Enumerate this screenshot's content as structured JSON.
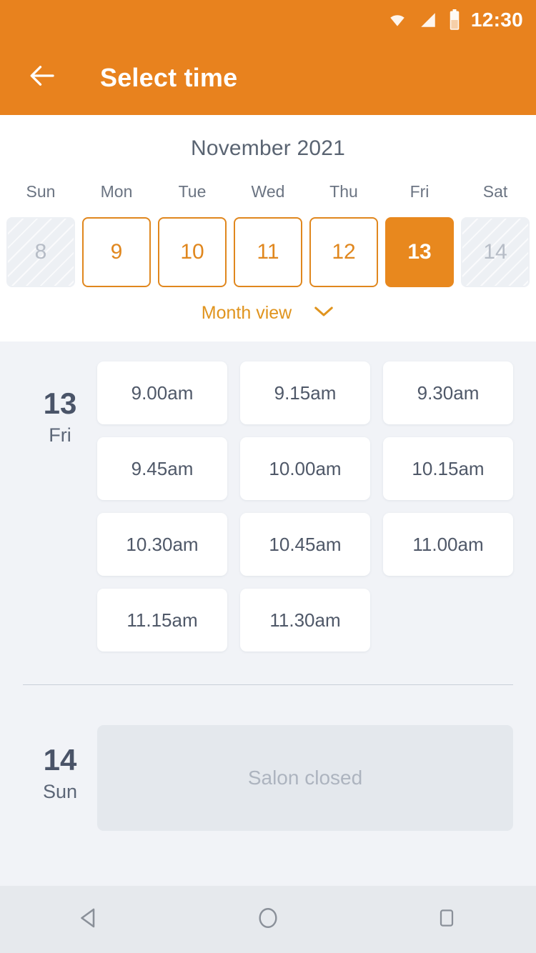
{
  "statusbar": {
    "time": "12:30",
    "icons": [
      "wifi-icon",
      "cell-signal-icon",
      "battery-icon"
    ]
  },
  "appbar": {
    "title": "Select time",
    "back_icon": "arrow-left-icon"
  },
  "calendar": {
    "month_label": "November 2021",
    "weekdays": [
      "Sun",
      "Mon",
      "Tue",
      "Wed",
      "Thu",
      "Fri",
      "Sat"
    ],
    "dates": [
      {
        "day": "8",
        "state": "disabled"
      },
      {
        "day": "9",
        "state": "available"
      },
      {
        "day": "10",
        "state": "available"
      },
      {
        "day": "11",
        "state": "available"
      },
      {
        "day": "12",
        "state": "available"
      },
      {
        "day": "13",
        "state": "selected"
      },
      {
        "day": "14",
        "state": "disabled"
      }
    ],
    "month_view_label": "Month view",
    "month_view_icon": "chevron-down-icon"
  },
  "days": [
    {
      "day_number": "13",
      "day_of_week": "Fri",
      "slots": [
        "9.00am",
        "9.15am",
        "9.30am",
        "9.45am",
        "10.00am",
        "10.15am",
        "10.30am",
        "10.45am",
        "11.00am",
        "11.15am",
        "11.30am"
      ]
    },
    {
      "day_number": "14",
      "day_of_week": "Sun",
      "closed_message": "Salon closed"
    }
  ],
  "navbar": {
    "back_icon": "nav-back-triangle-icon",
    "home_icon": "nav-home-circle-icon",
    "recents_icon": "nav-recents-square-icon"
  },
  "colors": {
    "accent_orange": "#E8821E",
    "selected_orange": "#E8881E",
    "page_background": "#F1F3F7",
    "panel_white": "#FFFFFF",
    "text_slate": "#4A5468",
    "muted_gray": "#ADB4BF",
    "closed_box": "#E4E8ED"
  }
}
